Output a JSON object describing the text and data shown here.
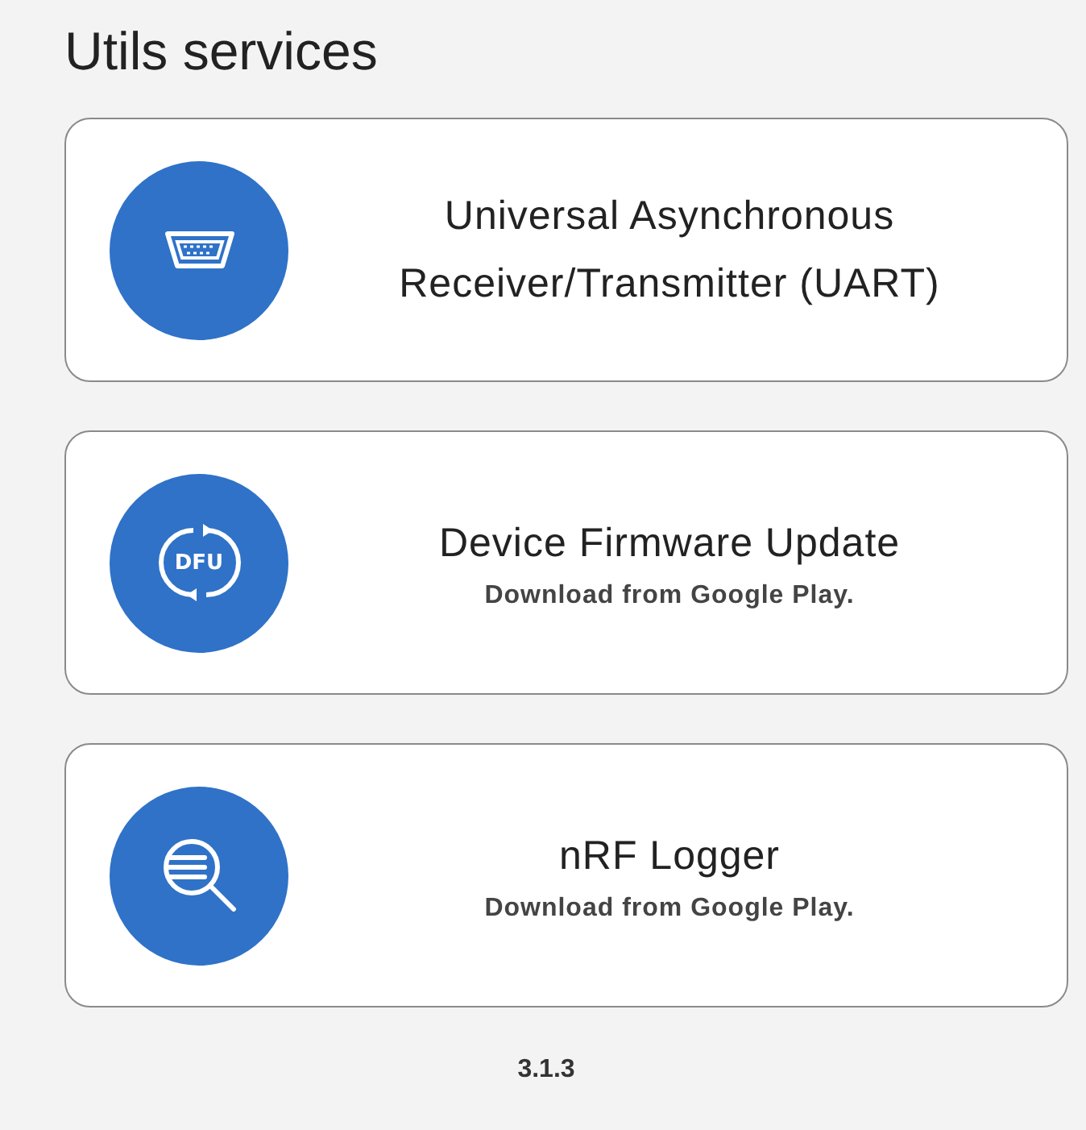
{
  "title": "Utils services",
  "services": [
    {
      "kind": "uart",
      "lines": [
        "Universal Asynchronous",
        "Receiver/Transmitter (UART)"
      ]
    },
    {
      "kind": "dfu",
      "icon_label": "DFU",
      "lines": [
        "Device Firmware Update"
      ],
      "subtitle": "Download from Google Play."
    },
    {
      "kind": "logger",
      "lines": [
        "nRF Logger"
      ],
      "subtitle": "Download from Google Play."
    }
  ],
  "version": "3.1.3"
}
